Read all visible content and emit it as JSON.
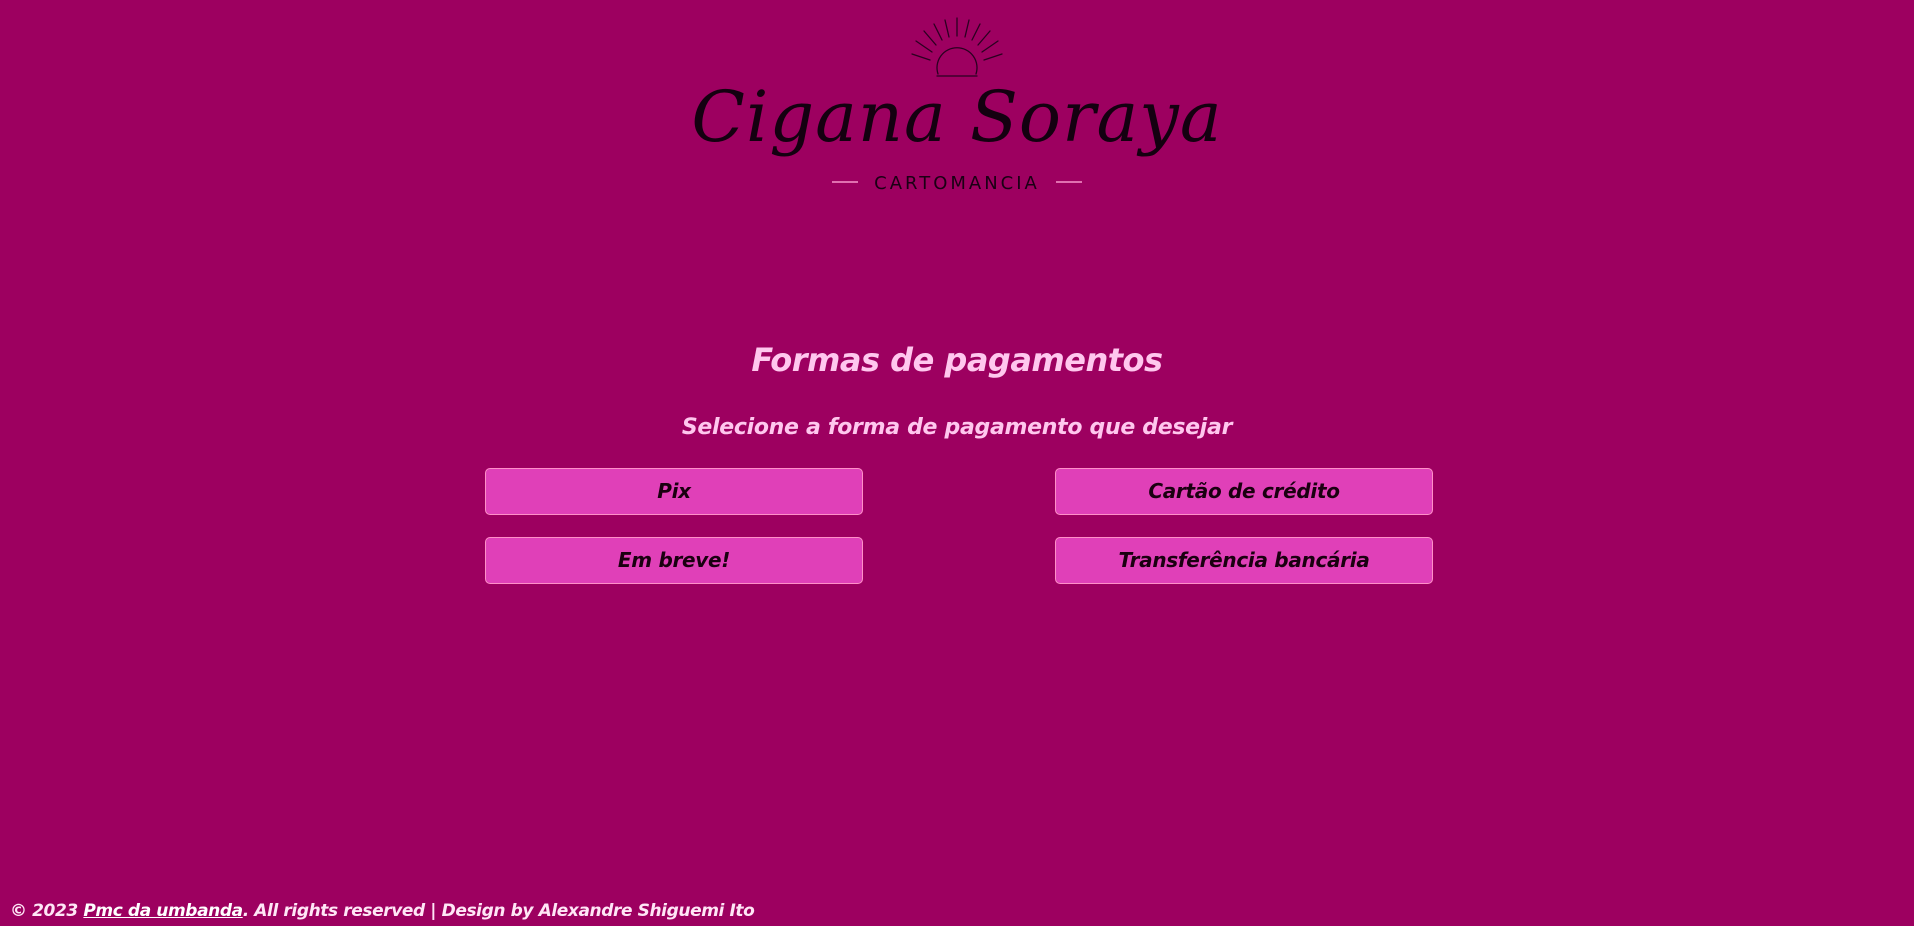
{
  "logo": {
    "name": "Cigana Soraya",
    "subtitle": "CARTOMANCIA",
    "icon": "crystal-ball-sun-icon"
  },
  "main": {
    "title": "Formas de pagamentos",
    "subtitle": "Selecione a forma de pagamento que desejar"
  },
  "payment_options": {
    "pix": "Pix",
    "credit_card": "Cartão de crédito",
    "coming_soon": "Em breve!",
    "bank_transfer": "Transferência bancária"
  },
  "footer": {
    "prefix": "© 2023 ",
    "link": "Pmc da umbanda",
    "suffix": ". All rights reserved | Design by Alexandre Shiguemi Ito"
  },
  "colors": {
    "background": "#9d0060",
    "button": "#e040b8",
    "button_border": "#ff8fc8",
    "heading": "#ffc7ee",
    "logo_ink": "#140010"
  }
}
